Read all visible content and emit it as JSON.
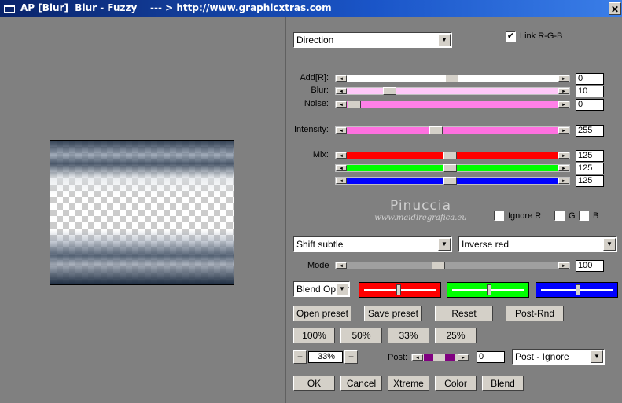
{
  "window": {
    "title": "AP [Blur]  Blur - Fuzzy    --- > http://www.graphicxtras.com",
    "close_label": "✕"
  },
  "controls": {
    "direction_select": "Direction",
    "link_rgb_label": "Link R-G-B",
    "link_rgb_checked": true,
    "check_mark": "✔",
    "sliders": [
      {
        "label": "Add[R]:",
        "value": "0",
        "fill": 0.5,
        "color": "#ffffff"
      },
      {
        "label": "Blur:",
        "value": "10",
        "fill": 0.18,
        "color": "#ffc8f8"
      },
      {
        "label": "Noise:",
        "value": "0",
        "fill": 0.0,
        "color": "#ff80e8"
      },
      {
        "label": "Intensity:",
        "value": "255",
        "fill": 0.42,
        "color": "#ff70e0"
      },
      {
        "label": "Mix:",
        "value": "125",
        "fill": 0.49,
        "color": "#ff0000"
      },
      {
        "label": "",
        "value": "125",
        "fill": 0.49,
        "color": "#00ff00"
      },
      {
        "label": "",
        "value": "125",
        "fill": 0.49,
        "color": "#0000ff"
      }
    ],
    "watermark": {
      "name": "Pinuccia",
      "url": "www.maidiregrafica.eu"
    },
    "ignore_r_label": "Ignore R",
    "g_label": "G",
    "b_label": "B",
    "shift_select": "Shift subtle",
    "inverse_select": "Inverse red",
    "mode_label": "Mode",
    "mode_value": "100",
    "mode_fill": 0.43,
    "blend_select": "Blend Options",
    "channel_levels": {
      "red": 0.47,
      "green": 0.5,
      "blue": 0.5
    },
    "buttons_row1": [
      "Open preset",
      "Save preset",
      "Reset",
      "Post-Rnd"
    ],
    "buttons_row2": [
      "100%",
      "50%",
      "33%",
      "25%"
    ],
    "zoom": {
      "plus": "+",
      "value": "33%",
      "minus": "−"
    },
    "post_label": "Post:",
    "post_value": "0",
    "post_select": "Post - Ignore",
    "buttons_row3": [
      "OK",
      "Cancel",
      "Xtreme",
      "Color",
      "Blend"
    ]
  }
}
